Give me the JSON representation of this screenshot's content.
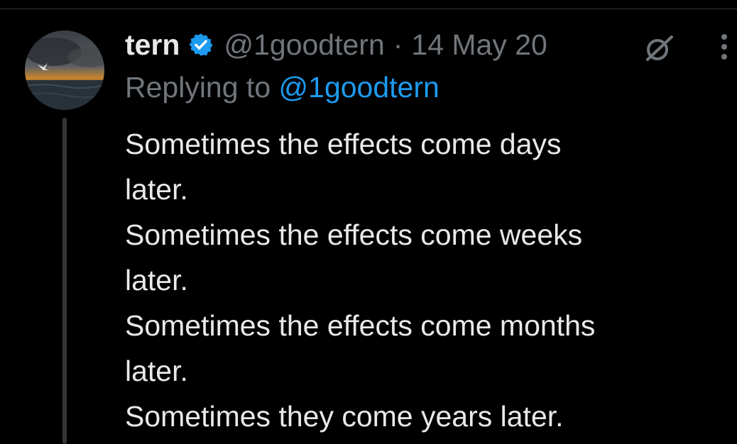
{
  "tweet": {
    "author_name": "tern",
    "handle": "@1goodtern",
    "separator": "·",
    "date": "14 May 20",
    "reply_prefix": "Replying to",
    "reply_to": "@1goodtern",
    "lines": [
      "Sometimes the effects come days",
      "later.",
      "Sometimes the effects come weeks",
      "later.",
      "Sometimes the effects come months",
      "later.",
      "Sometimes they come years later."
    ]
  },
  "icons": {
    "verified": "verified-badge-icon",
    "grok": "grok-icon",
    "more": "more-vertical-icon",
    "avatar": "avatar-image"
  },
  "colors": {
    "background": "#000000",
    "text_primary": "#e7e9ea",
    "text_secondary": "#71767b",
    "accent": "#1d9bf0",
    "divider": "#2f3336"
  }
}
